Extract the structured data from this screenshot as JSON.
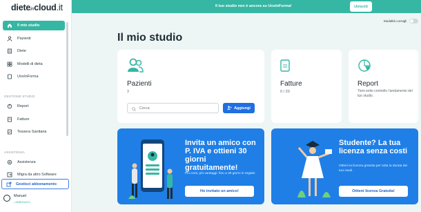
{
  "app": {
    "logo_main": "diete",
    "logo_in": "in",
    "logo_rest": "cloud",
    "logo_tld": ".it"
  },
  "banner": {
    "text": "Il tuo studio non è ancora su UnoInForma!",
    "button": "Unisciti"
  },
  "toggle": {
    "label": "Modalità consigli",
    "on": false
  },
  "sidebar": {
    "items": [
      {
        "label": "Il mio studio",
        "icon": "home-icon",
        "active": true
      },
      {
        "label": "Pazienti",
        "icon": "user-icon"
      },
      {
        "label": "Diete",
        "icon": "list-icon"
      },
      {
        "label": "Modelli di dieta",
        "icon": "grid-icon"
      },
      {
        "label": "UnoInForma",
        "icon": "document-icon"
      }
    ],
    "section_gestione": "GESTIONE STUDIO",
    "gestione_items": [
      {
        "label": "Report",
        "icon": "chart-icon"
      },
      {
        "label": "Fatture",
        "icon": "document-icon"
      },
      {
        "label": "Tessera Sanitaria",
        "icon": "card-icon"
      }
    ],
    "section_assistenza": "ASSISTENZA",
    "assistenza_items": [
      {
        "label": "Assistenza",
        "icon": "help-icon"
      },
      {
        "label": "Migra da altro Software",
        "icon": "migrate-icon"
      }
    ],
    "subscription": "Gestisci abbonamento",
    "user": {
      "name": "Manuel",
      "role": "• ABBONATO"
    }
  },
  "main": {
    "title": "Il mio studio",
    "pazienti": {
      "title": "Pazienti",
      "count": "3",
      "search_placeholder": "Cerca",
      "add": "Aggiungi"
    },
    "fatture": {
      "title": "Fatture",
      "count": "0 / 20"
    },
    "report": {
      "title": "Report",
      "text": "Tieni sotto controllo l'andamento del tuo studio."
    },
    "invite": {
      "title": "Invita un amico con P. IVA e ottieni 30 giorni gratuitamente!",
      "text": "Più inviti, più vantaggi: fino a 30 giorni in regalo!",
      "button": "Ho invitato un amico!"
    },
    "student": {
      "title": "Studente? La tua licenza senza costi",
      "text": "Ottieni la licenza gratuita per tutta la durata dei tuoi studi.",
      "button": "Ottieni licenza Gratuita!"
    }
  },
  "colors": {
    "accent": "#35b7a4",
    "primary_blue": "#1f7fe6"
  }
}
